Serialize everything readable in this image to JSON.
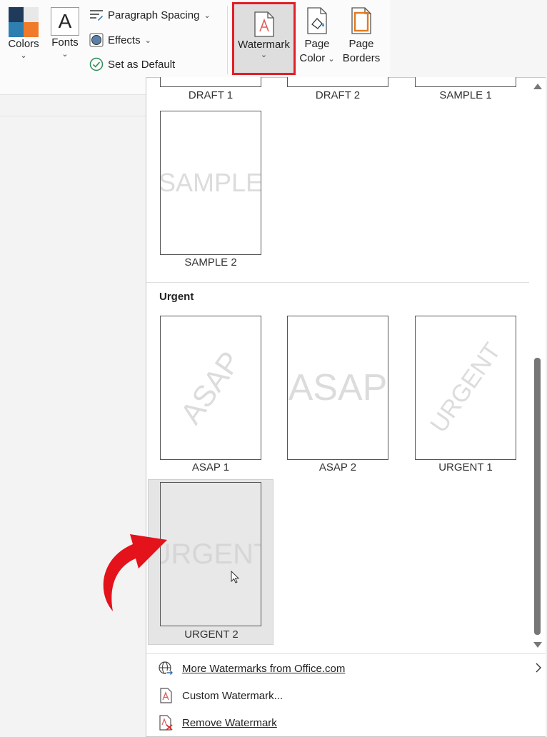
{
  "ribbon": {
    "colors_label": "Colors",
    "fonts_label": "Fonts",
    "fonts_glyph": "A",
    "paragraph_spacing": "Paragraph Spacing",
    "effects": "Effects",
    "set_as_default": "Set as Default",
    "watermark_label": "Watermark",
    "page_color": [
      "Page",
      "Color"
    ],
    "page_borders": [
      "Page",
      "Borders"
    ],
    "chevron": "⌄"
  },
  "gallery": {
    "top_row": [
      "DRAFT 1",
      "DRAFT 2",
      "SAMPLE 1"
    ],
    "sample2": {
      "caption": "SAMPLE 2",
      "watermark": "SAMPLE"
    },
    "section_heading": "Urgent",
    "urgent_row": [
      {
        "caption": "ASAP 1",
        "watermark": "ASAP"
      },
      {
        "caption": "ASAP 2",
        "watermark": "ASAP"
      },
      {
        "caption": "URGENT 1",
        "watermark": "URGENT"
      }
    ],
    "urgent2": {
      "caption": "URGENT 2",
      "watermark": "URGENT"
    }
  },
  "menu": {
    "more_watermarks": "More Watermarks from Office.com",
    "custom_watermark": "Custom Watermark...",
    "remove_watermark": "Remove Watermark"
  },
  "colors": {
    "highlight_red": "#e11f26",
    "arrow_red": "#e3121b",
    "hover_bg": "#e5e5e5",
    "scroll_thumb": "#777777"
  }
}
